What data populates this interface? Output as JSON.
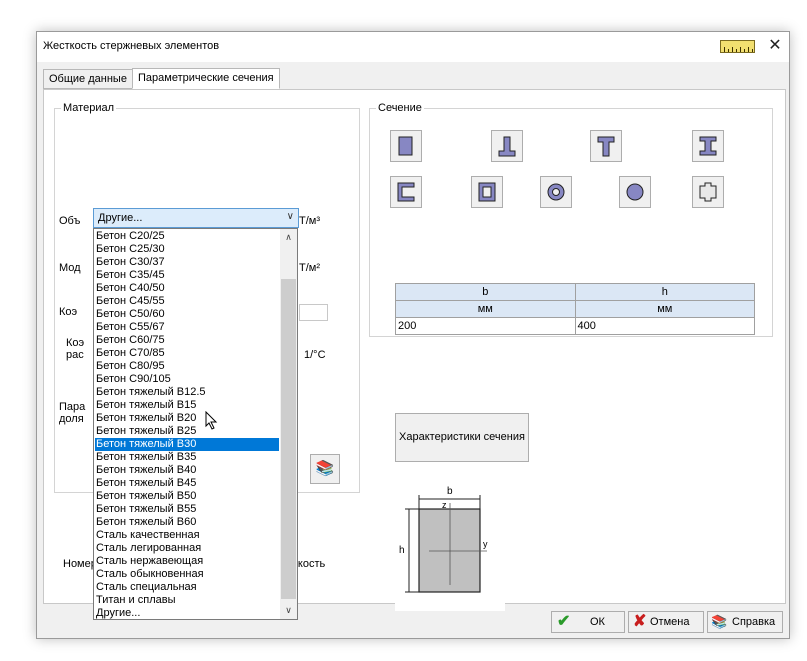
{
  "dialog": {
    "title": "Жесткость стержневых элементов",
    "close_glyph": "✕",
    "ruler_icon": "ruler-icon"
  },
  "tabs": [
    {
      "label": "Общие данные"
    },
    {
      "label": "Параметрические сечения"
    }
  ],
  "material": {
    "group_label": "Материал",
    "combo_value": "Другие...",
    "labels": [
      {
        "text": "Объ"
      },
      {
        "text": "Мод"
      },
      {
        "text": "Коэ"
      },
      {
        "text": "Коэ"
      },
      {
        "text": "рас"
      },
      {
        "text": "Пара"
      },
      {
        "text": "доля"
      }
    ],
    "units": [
      {
        "text": "Т/м³"
      },
      {
        "text": "Т/м²"
      },
      {
        "text": "1/°C"
      }
    ],
    "book_icon": "book-icon"
  },
  "dropdown": {
    "items": [
      "Бетон C20/25",
      "Бетон C25/30",
      "Бетон C30/37",
      "Бетон C35/45",
      "Бетон C40/50",
      "Бетон C45/55",
      "Бетон C50/60",
      "Бетон C55/67",
      "Бетон C60/75",
      "Бетон C70/85",
      "Бетон C80/95",
      "Бетон C90/105",
      "Бетон тяжелый В12.5",
      "Бетон тяжелый В15",
      "Бетон тяжелый В20",
      "Бетон тяжелый В25",
      "Бетон тяжелый В30",
      "Бетон тяжелый В35",
      "Бетон тяжелый В40",
      "Бетон тяжелый В45",
      "Бетон тяжелый В50",
      "Бетон тяжелый В55",
      "Бетон тяжелый В60",
      "Сталь качественная",
      "Сталь легированная",
      "Сталь нержавеющая",
      "Сталь обыкновенная",
      "Сталь специальная",
      "Титан и сплавы",
      "Другие..."
    ],
    "selected": "Бетон тяжелый В30"
  },
  "bottom_labels": {
    "type_number": "Номер типа жесткости",
    "new_stiffness": "Новая жесткость"
  },
  "section": {
    "group_label": "Сечение",
    "shapes": [
      "rectangle-section-icon",
      "t-inverted-section-icon",
      "t-section-icon",
      "i-beam-section-icon",
      "channel-section-icon",
      "box-section-icon",
      "ring-section-icon",
      "circle-section-icon",
      "cross-section-icon"
    ],
    "table": {
      "headers": [
        "b",
        "h"
      ],
      "units": [
        "мм",
        "мм"
      ],
      "values": [
        "200",
        "400"
      ]
    },
    "char_button": "Характеристики сечения",
    "diagram": {
      "b": "b",
      "h": "h",
      "z": "z",
      "y": "y"
    }
  },
  "buttons": {
    "ok": "ОК",
    "cancel": "Отмена",
    "help": "Справка"
  },
  "colors": {
    "accent": "#0078d7",
    "section_fill": "#8787c3",
    "ok_green": "#2a9a2a",
    "cancel_red": "#c81e1e"
  }
}
